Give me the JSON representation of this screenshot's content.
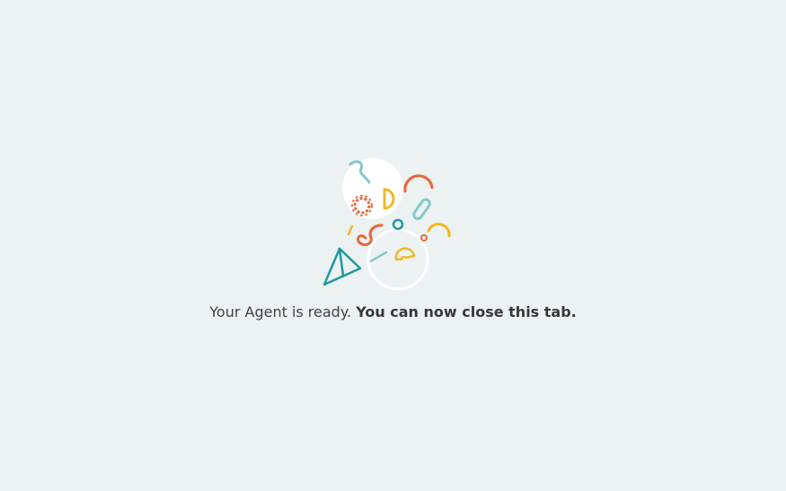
{
  "message": {
    "prefix": "Your Agent is ready.",
    "emphasis": "You can now close this tab."
  },
  "illustration": {
    "icon": "confetti-celebration-icon",
    "colors": {
      "teal": "#1e9aa0",
      "light_teal": "#86c8cc",
      "orange": "#e8663a",
      "yellow": "#f1b824",
      "white": "#ffffff"
    }
  }
}
